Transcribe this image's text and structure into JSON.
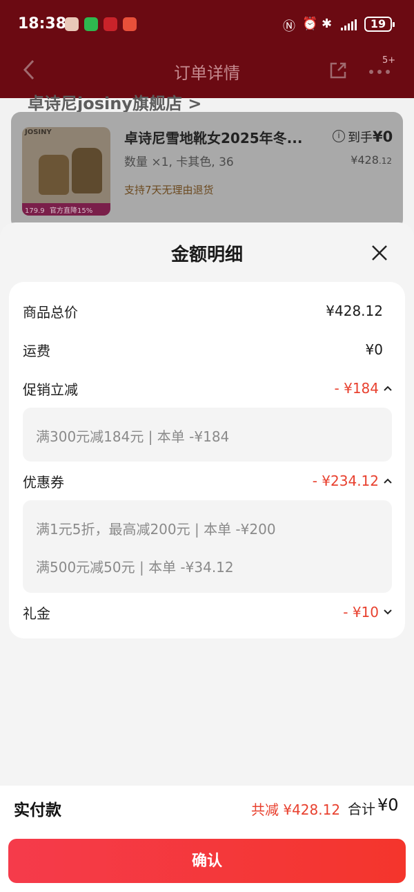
{
  "status_bar": {
    "time": "18:38",
    "battery": "19",
    "colors": {
      "bg": "#6b0a12"
    }
  },
  "nav": {
    "title": "订单详情",
    "more_badge": "5+"
  },
  "background": {
    "shop_name": "卓诗尼josiny旗舰店 >",
    "product": {
      "brand": "JOSINY",
      "name": "卓诗尼雪地靴女2025年冬...",
      "sku": "数量 ×1, 卡其色, 36",
      "return_policy": "支持7天无理由退货",
      "arrive_label": "到手",
      "arrive_value": "¥0",
      "price": "¥428",
      "price_cents": ".12",
      "img_price": "179.9",
      "img_promo": "官方直降15%"
    }
  },
  "sheet": {
    "title": "金额明细",
    "rows": {
      "goods_total": {
        "label": "商品总价",
        "value": "¥428.12"
      },
      "shipping": {
        "label": "运费",
        "value": "¥0"
      },
      "promotion": {
        "label": "促销立减",
        "value": "- ¥184",
        "details": [
          "满300元减184元 | 本单 -¥184"
        ]
      },
      "coupon": {
        "label": "优惠券",
        "value": "- ¥234.12",
        "details": [
          "满1元5折，最高减200元 | 本单 -¥200",
          "满500元减50元 | 本单 -¥34.12"
        ]
      },
      "gift": {
        "label": "礼金",
        "value": "- ¥10"
      }
    }
  },
  "footer": {
    "pay_label": "实付款",
    "saved": "共减 ¥428.12",
    "total_label": "合计",
    "total_value": "¥0",
    "confirm_label": "确认"
  },
  "colors": {
    "accent_red": "#e8402e",
    "button_red": "#f4352c"
  }
}
